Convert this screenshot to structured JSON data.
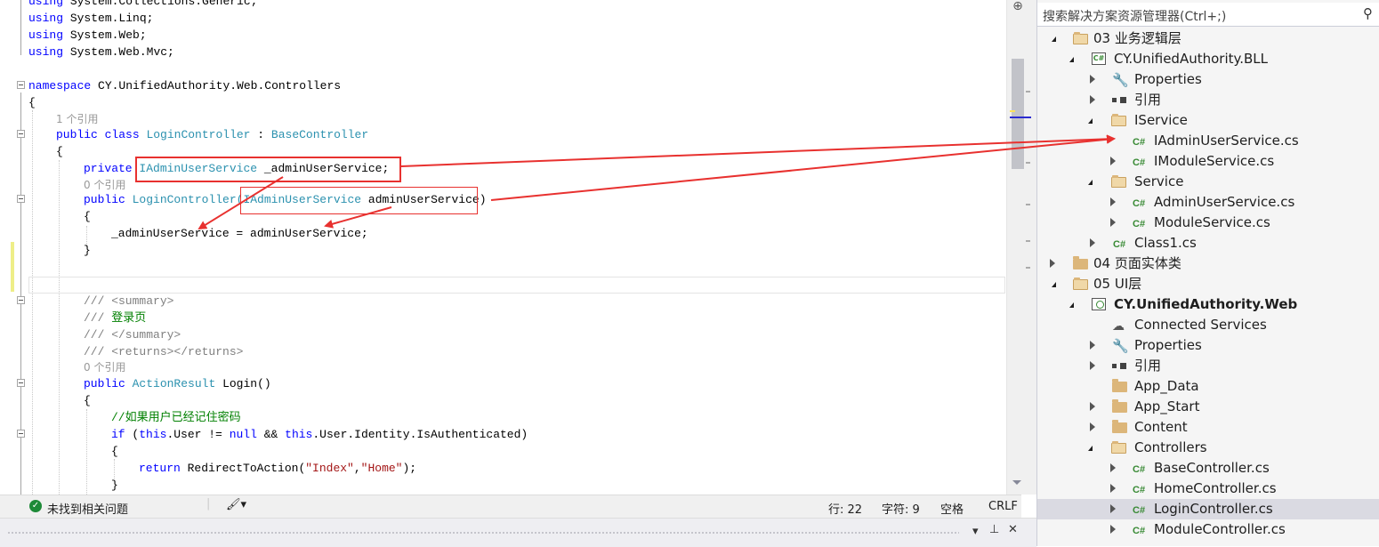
{
  "editor": {
    "lines": [
      {
        "y": -8,
        "indent": 0,
        "parts": [
          [
            "kw",
            "using"
          ],
          [
            "",
            "System.Collections.Generic;"
          ]
        ]
      },
      {
        "y": 11,
        "indent": 0,
        "parts": [
          [
            "kw",
            "using"
          ],
          [
            "",
            "System.Linq;"
          ]
        ]
      },
      {
        "y": 30,
        "indent": 0,
        "parts": [
          [
            "kw",
            "using"
          ],
          [
            "",
            "System.Web;"
          ]
        ]
      },
      {
        "y": 49,
        "indent": 0,
        "parts": [
          [
            "kw",
            "using"
          ],
          [
            "",
            "System.Web.Mvc;"
          ]
        ]
      }
    ],
    "code": {
      "l_using1": "System.Collections.Generic;",
      "l_using2": "System.Linq;",
      "l_using3": "System.Web;",
      "l_using4": "System.Web.Mvc;",
      "kw_using": "using",
      "kw_namespace": "namespace",
      "namespace_name": "CY.UnifiedAuthority.Web.Controllers",
      "open_brace": "{",
      "close_brace": "}",
      "lens_1_ref": "1 个引用",
      "lens_0_ref": "0 个引用",
      "kw_public": "public",
      "kw_class": "class",
      "class_name": "LoginController",
      "colon": ":",
      "base_class": "BaseController",
      "kw_private": "private",
      "type_iadmin": "IAdminUserService",
      "field_decl": "_adminUserService;",
      "ctor_name": "LoginController(",
      "ctor_param": "adminUserService)",
      "assign_stmt": "_adminUserService =",
      "assign_rhs": "adminUserService;",
      "doc_summary_open": "/// <summary>",
      "doc_text_prefix": "///",
      "doc_text": "登录页",
      "doc_summary_close": "/// </summary>",
      "doc_returns": "/// <returns></returns>",
      "type_action": "ActionResult",
      "method_login": "Login()",
      "comment_remember": "//如果用户已经记住密码",
      "kw_if": "if",
      "if_open": "(",
      "kw_this": "this",
      "if_mid1": ".User !=",
      "kw_null": "null",
      "if_mid2": "&&",
      "if_mid3": ".User.Identity.IsAuthenticated)",
      "kw_return": "return",
      "redirect_call": "RedirectToAction(",
      "str_index": "\"Index\"",
      "comma": ",",
      "str_home": "\"Home\"",
      "redirect_end": ");"
    }
  },
  "statusbar": {
    "no_issues": "未找到相关问题",
    "line": "行: 22",
    "char": "字符: 9",
    "spaces": "空格",
    "eol": "CRLF"
  },
  "solution_explorer": {
    "search_placeholder": "搜索解决方案资源管理器(Ctrl+;)",
    "items": [
      {
        "label": "03 业务逻辑层"
      },
      {
        "label": "CY.UnifiedAuthority.BLL"
      },
      {
        "label": "Properties"
      },
      {
        "label": "引用"
      },
      {
        "label": "IService"
      },
      {
        "label": "IAdminUserService.cs"
      },
      {
        "label": "IModuleService.cs"
      },
      {
        "label": "Service"
      },
      {
        "label": "AdminUserService.cs"
      },
      {
        "label": "ModuleService.cs"
      },
      {
        "label": "Class1.cs"
      },
      {
        "label": "04 页面实体类"
      },
      {
        "label": "05 UI层"
      },
      {
        "label": "CY.UnifiedAuthority.Web"
      },
      {
        "label": "Connected Services"
      },
      {
        "label": "Properties"
      },
      {
        "label": "引用"
      },
      {
        "label": "App_Data"
      },
      {
        "label": "App_Start"
      },
      {
        "label": "Content"
      },
      {
        "label": "Controllers"
      },
      {
        "label": "BaseController.cs"
      },
      {
        "label": "HomeController.cs"
      },
      {
        "label": "LoginController.cs"
      },
      {
        "label": "ModuleController.cs"
      }
    ],
    "csharp_badge": "C#"
  },
  "colors": {
    "keyword": "#0000ff",
    "type": "#2b91af",
    "comment": "#008000",
    "annotation_red": "#e8312f",
    "selection": "#dadae2"
  }
}
